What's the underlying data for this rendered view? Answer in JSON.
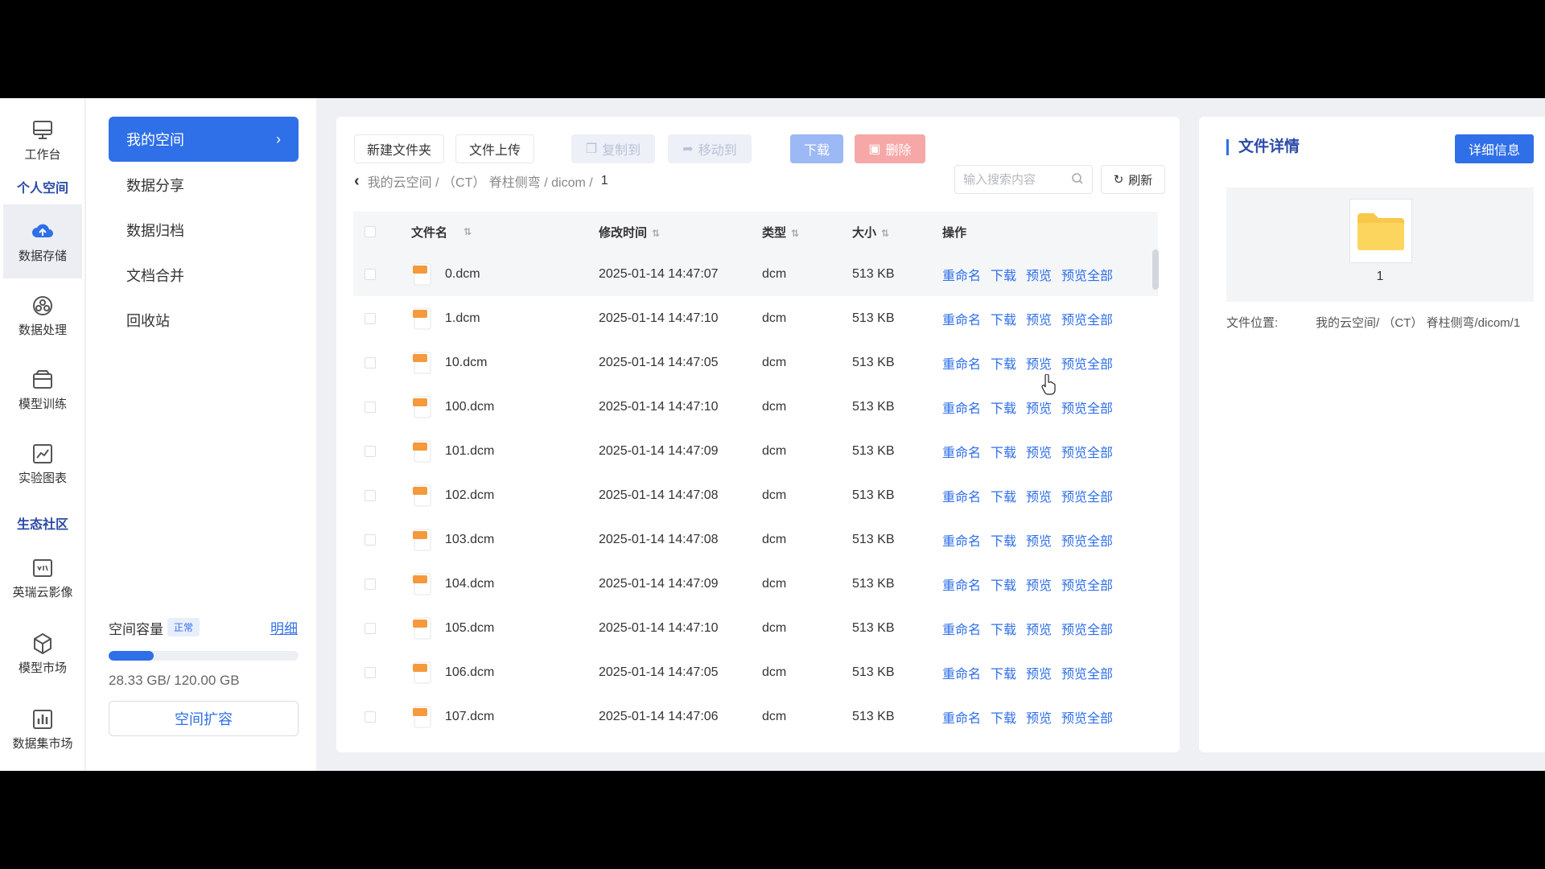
{
  "rail": {
    "items": [
      {
        "label": "工作台",
        "icon": "monitor-icon"
      },
      {
        "label": "数据存储",
        "icon": "cloud-upload-icon"
      },
      {
        "label": "数据处理",
        "icon": "data-process-icon"
      },
      {
        "label": "模型训练",
        "icon": "box-icon"
      },
      {
        "label": "实验图表",
        "icon": "line-chart-icon"
      },
      {
        "label": "英瑞云影像",
        "icon": "image-viewer-icon"
      },
      {
        "label": "模型市场",
        "icon": "hexagon-icon"
      },
      {
        "label": "数据集市场",
        "icon": "bar-chart-icon"
      }
    ],
    "sections": {
      "personal": "个人空间",
      "ecosystem": "生态社区"
    }
  },
  "subnav": {
    "items": [
      {
        "label": "我的空间"
      },
      {
        "label": "数据分享"
      },
      {
        "label": "数据归档"
      },
      {
        "label": "文档合并"
      },
      {
        "label": "回收站"
      }
    ],
    "capacity": {
      "label": "空间容量",
      "status": "正常",
      "detail_link": "明细",
      "usage_text": "28.33 GB/ 120.00 GB",
      "used_fraction": 0.236
    },
    "expand_button": "空间扩容"
  },
  "toolbar": {
    "new_folder": "新建文件夹",
    "upload": "文件上传",
    "copy_to": "复制到",
    "move_to": "移动到",
    "download": "下载",
    "delete": "删除",
    "search_placeholder": "输入搜索内容",
    "refresh": "刷新"
  },
  "breadcrumb": {
    "path": "我的云空间 /  （CT）  脊柱侧弯 / dicom /",
    "current": "1"
  },
  "table": {
    "headers": {
      "name": "文件名",
      "modified": "修改时间",
      "type": "类型",
      "size": "大小",
      "ops": "操作"
    },
    "op_labels": {
      "rename": "重命名",
      "download": "下载",
      "preview": "预览",
      "preview_all": "预览全部"
    },
    "rows": [
      {
        "name": "0.dcm",
        "modified": "2025-01-14 14:47:07",
        "type": "dcm",
        "size": "513 KB"
      },
      {
        "name": "1.dcm",
        "modified": "2025-01-14 14:47:10",
        "type": "dcm",
        "size": "513 KB"
      },
      {
        "name": "10.dcm",
        "modified": "2025-01-14 14:47:05",
        "type": "dcm",
        "size": "513 KB"
      },
      {
        "name": "100.dcm",
        "modified": "2025-01-14 14:47:10",
        "type": "dcm",
        "size": "513 KB"
      },
      {
        "name": "101.dcm",
        "modified": "2025-01-14 14:47:09",
        "type": "dcm",
        "size": "513 KB"
      },
      {
        "name": "102.dcm",
        "modified": "2025-01-14 14:47:08",
        "type": "dcm",
        "size": "513 KB"
      },
      {
        "name": "103.dcm",
        "modified": "2025-01-14 14:47:08",
        "type": "dcm",
        "size": "513 KB"
      },
      {
        "name": "104.dcm",
        "modified": "2025-01-14 14:47:09",
        "type": "dcm",
        "size": "513 KB"
      },
      {
        "name": "105.dcm",
        "modified": "2025-01-14 14:47:10",
        "type": "dcm",
        "size": "513 KB"
      },
      {
        "name": "106.dcm",
        "modified": "2025-01-14 14:47:05",
        "type": "dcm",
        "size": "513 KB"
      },
      {
        "name": "107.dcm",
        "modified": "2025-01-14 14:47:06",
        "type": "dcm",
        "size": "513 KB"
      }
    ]
  },
  "details": {
    "title": "文件详情",
    "button": "详细信息",
    "folder_name": "1",
    "location_label": "文件位置:",
    "location_value": "我的云空间/  （CT）  脊柱侧弯/dicom/1"
  },
  "colors": {
    "accent": "#2f6fe8",
    "section": "#2b4aa8",
    "delete": "#f6a7a7",
    "folder": "#f8c84a",
    "file": "#f59a3c"
  }
}
